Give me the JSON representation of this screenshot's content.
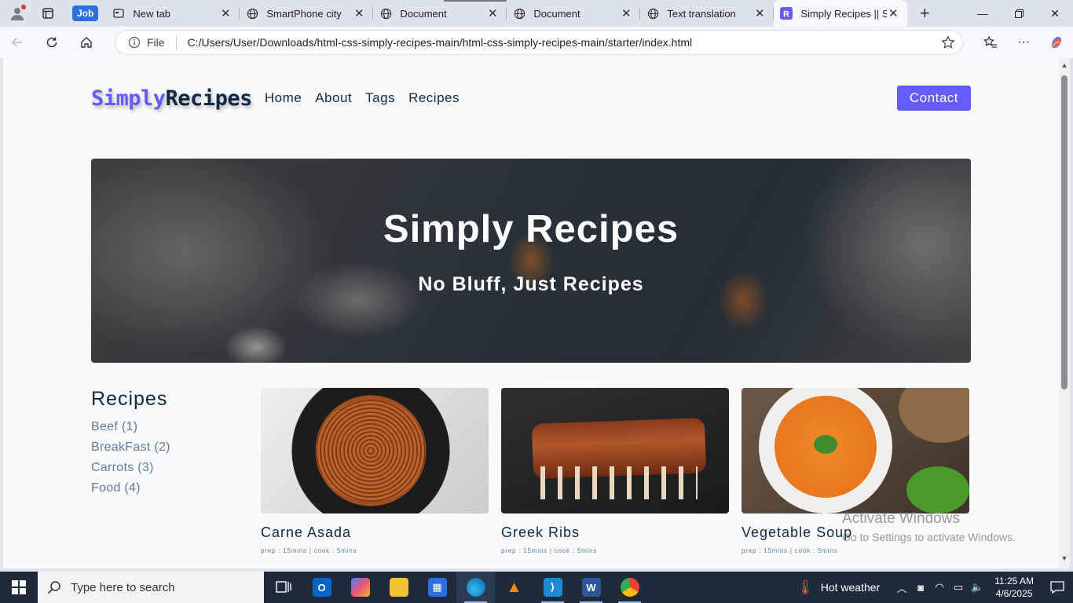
{
  "browser": {
    "workspace_label": "Job",
    "tabs": [
      {
        "label": "New tab",
        "icon": "newtab-icon"
      },
      {
        "label": "SmartPhone city",
        "icon": "globe-icon"
      },
      {
        "label": "Document",
        "icon": "globe-icon"
      },
      {
        "label": "Document",
        "icon": "globe-icon"
      },
      {
        "label": "Text translation",
        "icon": "globe-icon"
      },
      {
        "label": "Simply Recipes || Sta",
        "icon": "recipes-favicon",
        "active": true
      }
    ],
    "address": {
      "scheme_label": "File",
      "url": "C:/Users/User/Downloads/html-css-simply-recipes-main/html-css-simply-recipes-main/starter/index.html"
    }
  },
  "site": {
    "logo_part1": "Simply",
    "logo_part2": "Recipes",
    "nav": [
      "Home",
      "About",
      "Tags",
      "Recipes"
    ],
    "contact_label": "Contact",
    "hero": {
      "title": "Simply Recipes",
      "subtitle": "No Bluff, Just Recipes"
    },
    "sidebar": {
      "heading": "Recipes",
      "tags": [
        "Beef (1)",
        "BreakFast (2)",
        "Carrots (3)",
        "Food (4)"
      ]
    },
    "recipes": [
      {
        "title": "Carne Asada",
        "meta": "prep : 15mins | cook : 5mins"
      },
      {
        "title": "Greek Ribs",
        "meta": "prep : 15mins | cook : 5mins"
      },
      {
        "title": "Vegetable Soup",
        "meta": "prep : 15mins | cook : 5mins"
      }
    ],
    "colors": {
      "primary": "#645cff",
      "dark": "#102a42",
      "muted": "#617d98"
    }
  },
  "watermark": {
    "line1": "Activate Windows",
    "line2": "Go to Settings to activate Windows."
  },
  "taskbar": {
    "search_placeholder": "Type here to search",
    "weather": "Hot weather",
    "time": "11:25 AM",
    "date": "4/6/2025"
  }
}
